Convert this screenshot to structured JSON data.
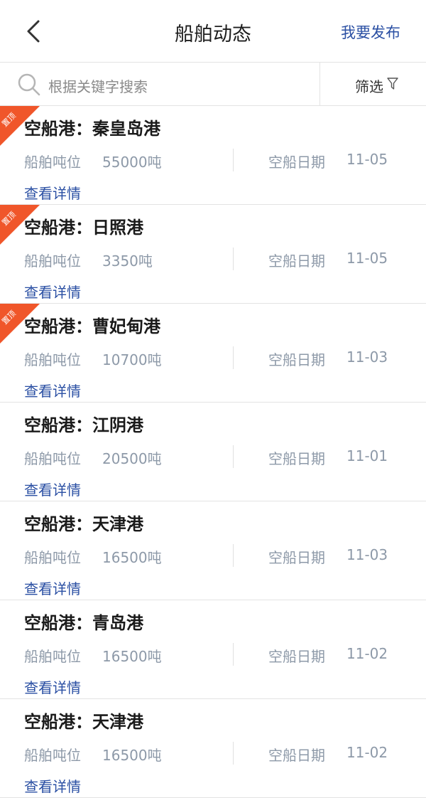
{
  "header": {
    "title": "船舶动态",
    "publish_label": "我要发布"
  },
  "search": {
    "placeholder": "根据关键字搜索",
    "filter_label": "筛选"
  },
  "badge_label": "置顶",
  "list_labels": {
    "tonnage_label": "船舶吨位",
    "date_label": "空船日期",
    "details_label": "查看详情"
  },
  "listings": [
    {
      "title": "空船港：秦皇岛港",
      "tonnage": "55000吨",
      "date": "11-05",
      "pinned": true
    },
    {
      "title": "空船港：日照港",
      "tonnage": "3350吨",
      "date": "11-05",
      "pinned": true
    },
    {
      "title": "空船港：曹妃甸港",
      "tonnage": "10700吨",
      "date": "11-03",
      "pinned": true
    },
    {
      "title": "空船港：江阴港",
      "tonnage": "20500吨",
      "date": "11-01",
      "pinned": false
    },
    {
      "title": "空船港：天津港",
      "tonnage": "16500吨",
      "date": "11-03",
      "pinned": false
    },
    {
      "title": "空船港：青岛港",
      "tonnage": "16500吨",
      "date": "11-02",
      "pinned": false
    },
    {
      "title": "空船港：天津港",
      "tonnage": "16500吨",
      "date": "11-02",
      "pinned": false
    }
  ],
  "colors": {
    "accent_blue": "#2a4fa3",
    "badge_orange": "#f0562a",
    "muted_text": "#8d99a8"
  }
}
